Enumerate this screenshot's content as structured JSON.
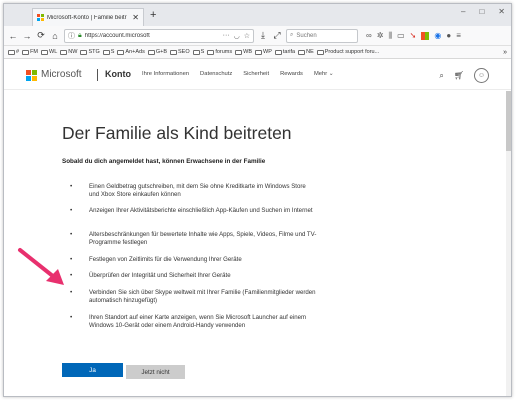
{
  "browser": {
    "tab_title": "Microsoft-Konto | Familie beitr",
    "tab_close": "✕",
    "new_tab": "+",
    "window_controls": [
      "‒",
      "□",
      "✕"
    ],
    "nav": {
      "back": "←",
      "forward": "→",
      "reload": "⟳",
      "home": "⌂"
    },
    "url": "https://account.microsoft",
    "url_dots": "···",
    "search_placeholder": "Suchen",
    "bookmarks": [
      {
        "label": "#"
      },
      {
        "label": "FM"
      },
      {
        "label": "WL"
      },
      {
        "label": "NW"
      },
      {
        "label": "STG"
      },
      {
        "label": "S"
      },
      {
        "label": "An+Ads"
      },
      {
        "label": "G+B"
      },
      {
        "label": "SEO"
      },
      {
        "label": "S"
      },
      {
        "label": "forums"
      },
      {
        "label": "WB"
      },
      {
        "label": "WP"
      },
      {
        "label": "tarifa"
      },
      {
        "label": "NE"
      },
      {
        "label": "Product support foru..."
      }
    ],
    "bookmarks_more": "»"
  },
  "ms_header": {
    "logo_text": "Microsoft",
    "logo_colors": [
      "#f25022",
      "#7fba00",
      "#00a4ef",
      "#ffb900"
    ],
    "account_label": "Konto",
    "nav_items": [
      "Ihre Informationen",
      "Datenschutz",
      "Sicherheit",
      "Rewards",
      "Mehr ⌄"
    ]
  },
  "content": {
    "title": "Der Familie als Kind beitreten",
    "intro": "Sobald du dich angemeldet hast, können Erwachsene in der Familie",
    "items": [
      "Einen Geldbetrag gutschreiben, mit dem Sie ohne Kreditkarte im Windows Store und Xbox Store einkaufen können",
      "Anzeigen Ihrer Aktivitätsberichte einschließlich App-Käufen und Suchen im Internet",
      "Altersbeschränkungen für bewertete Inhalte wie Apps, Spiele, Videos, Filme und TV-Programme festlegen",
      "Festlegen von Zeitlimits für die Verwendung Ihrer Geräte",
      "Überprüfen der Integrität und Sicherheit Ihrer Geräte",
      "Verbinden Sie sich über Skype weltweit mit Ihrer Familie (Familienmitglieder werden automatisch hinzugefügt)",
      "Ihren Standort auf einer Karte anzeigen, wenn Sie Microsoft Launcher auf einem Windows 10-Gerät oder einem Android-Handy verwenden"
    ],
    "bullet": "•",
    "btn_yes": "Ja",
    "btn_no": "Jetzt nicht"
  },
  "colors": {
    "primary_button": "#0067b8",
    "secondary_button": "#cccccc",
    "annotation_arrow": "#e8306e"
  }
}
